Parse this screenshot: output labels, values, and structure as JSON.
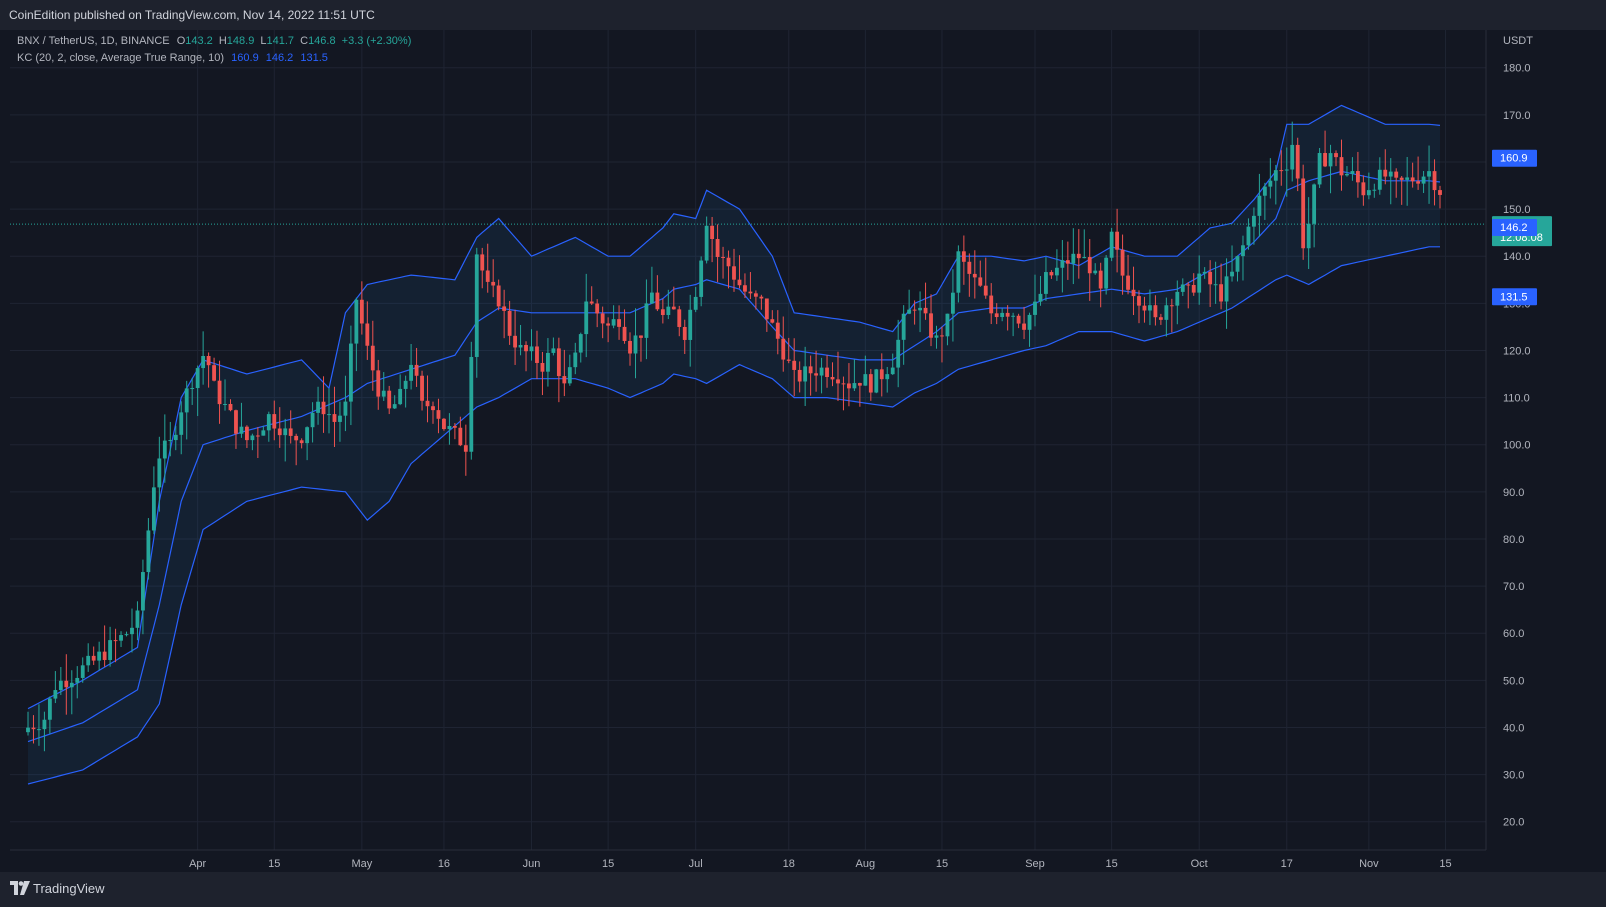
{
  "header": {
    "publisher": "CoinEdition published on TradingView.com, Nov 14, 2022 11:51 UTC"
  },
  "legend": {
    "symbol": "BNX / TetherUS, 1D, BINANCE",
    "o_label": "O",
    "o_value": "143.2",
    "h_label": "H",
    "h_value": "148.9",
    "l_label": "L",
    "l_value": "141.7",
    "c_label": "C",
    "c_value": "146.8",
    "change": "+3.3 (+2.30%)",
    "indicator": "KC (20, 2, close, Average True Range, 10)",
    "kc_upper": "160.9",
    "kc_mid": "146.2",
    "kc_lower": "131.5"
  },
  "footer": {
    "brand": "TradingView"
  },
  "colors": {
    "up": "#26a69a",
    "down": "#ef5350",
    "band": "#2962ff",
    "price_badge": "#26a69a"
  },
  "chart_data": {
    "type": "candlestick",
    "currency": "USDT",
    "ylim": [
      14,
      188
    ],
    "y_ticks": [
      20,
      30,
      40,
      50,
      60,
      70,
      80,
      90,
      100,
      110,
      120,
      130,
      140,
      150,
      160,
      170,
      180
    ],
    "x_ticks": [
      {
        "label": "Apr",
        "date": "2022-04-01"
      },
      {
        "label": "15",
        "date": "2022-04-15"
      },
      {
        "label": "May",
        "date": "2022-05-01"
      },
      {
        "label": "16",
        "date": "2022-05-16"
      },
      {
        "label": "Jun",
        "date": "2022-06-01"
      },
      {
        "label": "15",
        "date": "2022-06-15"
      },
      {
        "label": "Jul",
        "date": "2022-07-01"
      },
      {
        "label": "18",
        "date": "2022-07-18"
      },
      {
        "label": "Aug",
        "date": "2022-08-01"
      },
      {
        "label": "15",
        "date": "2022-08-15"
      },
      {
        "label": "Sep",
        "date": "2022-09-01"
      },
      {
        "label": "15",
        "date": "2022-09-15"
      },
      {
        "label": "Oct",
        "date": "2022-10-01"
      },
      {
        "label": "17",
        "date": "2022-10-17"
      },
      {
        "label": "Nov",
        "date": "2022-11-01"
      },
      {
        "label": "15",
        "date": "2022-11-15"
      }
    ],
    "first_date": "2022-03-01",
    "last_date": "2022-11-14",
    "close_key": [
      [
        0,
        40
      ],
      [
        3,
        42
      ],
      [
        5,
        49
      ],
      [
        8,
        51
      ],
      [
        12,
        54
      ],
      [
        15,
        57
      ],
      [
        18,
        60
      ],
      [
        20,
        63
      ],
      [
        21,
        73
      ],
      [
        22,
        82
      ],
      [
        23,
        92
      ],
      [
        24,
        98
      ],
      [
        26,
        100
      ],
      [
        28,
        108
      ],
      [
        30,
        114
      ],
      [
        32,
        119
      ],
      [
        33,
        117
      ],
      [
        34,
        112
      ],
      [
        36,
        108
      ],
      [
        38,
        104
      ],
      [
        40,
        101
      ],
      [
        42,
        103
      ],
      [
        44,
        106
      ],
      [
        46,
        104
      ],
      [
        48,
        101
      ],
      [
        50,
        102
      ],
      [
        52,
        107
      ],
      [
        54,
        108
      ],
      [
        56,
        105
      ],
      [
        58,
        108
      ],
      [
        60,
        131
      ],
      [
        62,
        120
      ],
      [
        64,
        112
      ],
      [
        66,
        107
      ],
      [
        68,
        110
      ],
      [
        70,
        118
      ],
      [
        72,
        108
      ],
      [
        74,
        109
      ],
      [
        76,
        104
      ],
      [
        78,
        102
      ],
      [
        80,
        100
      ],
      [
        82,
        141
      ],
      [
        84,
        133
      ],
      [
        86,
        131
      ],
      [
        88,
        124
      ],
      [
        90,
        120
      ],
      [
        92,
        119
      ],
      [
        94,
        117
      ],
      [
        96,
        120
      ],
      [
        98,
        112
      ],
      [
        100,
        118
      ],
      [
        102,
        131
      ],
      [
        104,
        128
      ],
      [
        106,
        125
      ],
      [
        108,
        127
      ],
      [
        110,
        121
      ],
      [
        112,
        124
      ],
      [
        114,
        132
      ],
      [
        116,
        127
      ],
      [
        118,
        128
      ],
      [
        120,
        124
      ],
      [
        122,
        133
      ],
      [
        124,
        148
      ],
      [
        126,
        140
      ],
      [
        128,
        138
      ],
      [
        130,
        134
      ],
      [
        132,
        131
      ],
      [
        134,
        130
      ],
      [
        136,
        125
      ],
      [
        138,
        120
      ],
      [
        140,
        114
      ],
      [
        142,
        115
      ],
      [
        144,
        116
      ],
      [
        146,
        116
      ],
      [
        148,
        115
      ],
      [
        150,
        113
      ],
      [
        152,
        114
      ],
      [
        154,
        113
      ],
      [
        156,
        115
      ],
      [
        158,
        118
      ],
      [
        160,
        126
      ],
      [
        162,
        130
      ],
      [
        164,
        126
      ],
      [
        166,
        122
      ],
      [
        168,
        126
      ],
      [
        170,
        140
      ],
      [
        172,
        136
      ],
      [
        174,
        133
      ],
      [
        176,
        128
      ],
      [
        178,
        129
      ],
      [
        180,
        128
      ],
      [
        182,
        126
      ],
      [
        184,
        129
      ],
      [
        186,
        135
      ],
      [
        188,
        137
      ],
      [
        190,
        139
      ],
      [
        192,
        140
      ],
      [
        194,
        138
      ],
      [
        196,
        132
      ],
      [
        198,
        144
      ],
      [
        200,
        136
      ],
      [
        202,
        133
      ],
      [
        204,
        130
      ],
      [
        206,
        126
      ],
      [
        208,
        130
      ],
      [
        210,
        133
      ],
      [
        212,
        132
      ],
      [
        214,
        136
      ],
      [
        216,
        134
      ],
      [
        218,
        132
      ],
      [
        220,
        136
      ],
      [
        222,
        142
      ],
      [
        224,
        150
      ],
      [
        226,
        154
      ],
      [
        228,
        158
      ],
      [
        230,
        160
      ],
      [
        231,
        164
      ],
      [
        232,
        156
      ],
      [
        233,
        143
      ],
      [
        234,
        147
      ],
      [
        236,
        160
      ],
      [
        238,
        162
      ],
      [
        240,
        158
      ],
      [
        242,
        157
      ],
      [
        244,
        154
      ],
      [
        246,
        156
      ],
      [
        248,
        157
      ],
      [
        250,
        155
      ],
      [
        252,
        156
      ],
      [
        254,
        157
      ],
      [
        256,
        158
      ],
      [
        258,
        154
      ],
      [
        260,
        156
      ],
      [
        262,
        157
      ],
      [
        264,
        154
      ],
      [
        266,
        150
      ],
      [
        268,
        146
      ],
      [
        270,
        149
      ],
      [
        272,
        145
      ],
      [
        274,
        144
      ],
      [
        276,
        146
      ],
      [
        278,
        145
      ],
      [
        280,
        146
      ],
      [
        282,
        138
      ],
      [
        284,
        145
      ],
      [
        286,
        144
      ],
      [
        288,
        146
      ],
      [
        290,
        145
      ],
      [
        292,
        147
      ],
      [
        294,
        146
      ],
      [
        296,
        144
      ],
      [
        298,
        147
      ],
      [
        300,
        146
      ],
      [
        302,
        146
      ],
      [
        305,
        146.8
      ]
    ],
    "wick_range": [
      4,
      10
    ],
    "kc_upper": [
      [
        0,
        44
      ],
      [
        10,
        50
      ],
      [
        20,
        57
      ],
      [
        24,
        88
      ],
      [
        28,
        110
      ],
      [
        32,
        118
      ],
      [
        40,
        115
      ],
      [
        50,
        118
      ],
      [
        55,
        112
      ],
      [
        58,
        128
      ],
      [
        62,
        134
      ],
      [
        70,
        136
      ],
      [
        78,
        135
      ],
      [
        82,
        144
      ],
      [
        86,
        148
      ],
      [
        92,
        140
      ],
      [
        100,
        144
      ],
      [
        106,
        140
      ],
      [
        110,
        140
      ],
      [
        116,
        146
      ],
      [
        118,
        149
      ],
      [
        122,
        148
      ],
      [
        124,
        154
      ],
      [
        130,
        150
      ],
      [
        136,
        140
      ],
      [
        140,
        128
      ],
      [
        146,
        127
      ],
      [
        152,
        126
      ],
      [
        158,
        124
      ],
      [
        162,
        130
      ],
      [
        166,
        132
      ],
      [
        170,
        140
      ],
      [
        176,
        140
      ],
      [
        182,
        139
      ],
      [
        186,
        140
      ],
      [
        192,
        138
      ],
      [
        198,
        142
      ],
      [
        204,
        140
      ],
      [
        210,
        140
      ],
      [
        216,
        146
      ],
      [
        220,
        147
      ],
      [
        224,
        152
      ],
      [
        228,
        158
      ],
      [
        230,
        168
      ],
      [
        234,
        168
      ],
      [
        240,
        172
      ],
      [
        248,
        168
      ],
      [
        256,
        168
      ],
      [
        264,
        167
      ],
      [
        272,
        163
      ],
      [
        280,
        158
      ],
      [
        288,
        159
      ],
      [
        296,
        159
      ],
      [
        302,
        161.5
      ],
      [
        305,
        160.9
      ]
    ],
    "kc_mid": [
      [
        0,
        37
      ],
      [
        10,
        41
      ],
      [
        20,
        48
      ],
      [
        24,
        66
      ],
      [
        28,
        88
      ],
      [
        32,
        100
      ],
      [
        40,
        103
      ],
      [
        50,
        106
      ],
      [
        58,
        110
      ],
      [
        62,
        113
      ],
      [
        70,
        116
      ],
      [
        78,
        119
      ],
      [
        82,
        126
      ],
      [
        86,
        129
      ],
      [
        92,
        128
      ],
      [
        100,
        128
      ],
      [
        106,
        128
      ],
      [
        110,
        128
      ],
      [
        116,
        131
      ],
      [
        118,
        133
      ],
      [
        122,
        134
      ],
      [
        124,
        135
      ],
      [
        130,
        133
      ],
      [
        136,
        125
      ],
      [
        140,
        120
      ],
      [
        146,
        119
      ],
      [
        152,
        118
      ],
      [
        158,
        118
      ],
      [
        162,
        121
      ],
      [
        166,
        124
      ],
      [
        170,
        128
      ],
      [
        176,
        129
      ],
      [
        182,
        129
      ],
      [
        186,
        131
      ],
      [
        192,
        132
      ],
      [
        198,
        133
      ],
      [
        204,
        132
      ],
      [
        210,
        133
      ],
      [
        216,
        137
      ],
      [
        220,
        139
      ],
      [
        224,
        143
      ],
      [
        228,
        148
      ],
      [
        230,
        154
      ],
      [
        234,
        156
      ],
      [
        240,
        158
      ],
      [
        248,
        156
      ],
      [
        256,
        156
      ],
      [
        264,
        155
      ],
      [
        272,
        150
      ],
      [
        280,
        147
      ],
      [
        288,
        147
      ],
      [
        296,
        146.5
      ],
      [
        305,
        146.2
      ]
    ],
    "kc_lower": [
      [
        0,
        28
      ],
      [
        10,
        31
      ],
      [
        20,
        38
      ],
      [
        24,
        45
      ],
      [
        28,
        66
      ],
      [
        32,
        82
      ],
      [
        40,
        88
      ],
      [
        50,
        91
      ],
      [
        58,
        90
      ],
      [
        62,
        84
      ],
      [
        66,
        88
      ],
      [
        70,
        96
      ],
      [
        78,
        104
      ],
      [
        82,
        108
      ],
      [
        86,
        110
      ],
      [
        92,
        114
      ],
      [
        100,
        114
      ],
      [
        106,
        112
      ],
      [
        110,
        110
      ],
      [
        116,
        113
      ],
      [
        118,
        115
      ],
      [
        122,
        114
      ],
      [
        124,
        113
      ],
      [
        130,
        117
      ],
      [
        136,
        114
      ],
      [
        140,
        110
      ],
      [
        146,
        110
      ],
      [
        152,
        109
      ],
      [
        158,
        108
      ],
      [
        162,
        111
      ],
      [
        166,
        113
      ],
      [
        170,
        116
      ],
      [
        176,
        118
      ],
      [
        182,
        120
      ],
      [
        186,
        121
      ],
      [
        192,
        124
      ],
      [
        198,
        124
      ],
      [
        204,
        122
      ],
      [
        210,
        124
      ],
      [
        216,
        127
      ],
      [
        220,
        129
      ],
      [
        224,
        132
      ],
      [
        228,
        135
      ],
      [
        230,
        136
      ],
      [
        234,
        134
      ],
      [
        240,
        138
      ],
      [
        248,
        140
      ],
      [
        256,
        142
      ],
      [
        264,
        142
      ],
      [
        272,
        138
      ],
      [
        280,
        136
      ],
      [
        288,
        132
      ],
      [
        296,
        132
      ],
      [
        300,
        131.5
      ],
      [
        305,
        131.5
      ]
    ],
    "last_price": 146.8,
    "badges": [
      {
        "value": "160.9",
        "price": 160.9,
        "color": "#2962ff"
      },
      {
        "value": "146.8",
        "price": 146.8,
        "color": "#26a69a",
        "sub": "12:08:08"
      },
      {
        "value": "146.2",
        "price": 146.2,
        "color": "#2962ff"
      },
      {
        "value": "131.5",
        "price": 131.5,
        "color": "#2962ff"
      }
    ]
  }
}
